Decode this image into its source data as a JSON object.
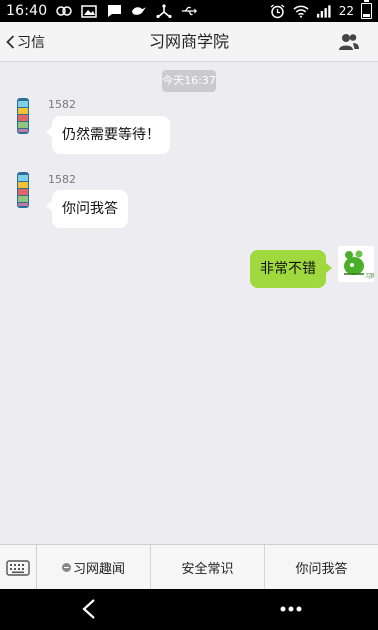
{
  "status_bar": {
    "time": "16:40",
    "battery_level": "22",
    "battery_fraction": 0.22,
    "icons": [
      "circles-icon",
      "image-icon",
      "message-icon",
      "bird-icon",
      "network-icon",
      "usb-icon",
      "alarm-icon",
      "wifi-icon",
      "signal-icon",
      "battery-icon"
    ]
  },
  "header": {
    "back_label": "习信",
    "title": "习网商学院",
    "right_icon": "people-icon"
  },
  "chat": {
    "timestamp": "今天16:37",
    "messages": [
      {
        "sender": "1582",
        "side": "left",
        "text": "仍然需要等待！"
      },
      {
        "sender": "1582",
        "side": "left",
        "text": "你问我答"
      },
      {
        "sender": "",
        "side": "right",
        "text": "非常不错",
        "avatar_text": "习网"
      }
    ]
  },
  "menu": {
    "keyboard_icon": "keyboard-icon",
    "items": [
      {
        "label": "习网趣闻",
        "has_submenu": true
      },
      {
        "label": "安全常识",
        "has_submenu": false
      },
      {
        "label": "你问我答",
        "has_submenu": false
      }
    ]
  },
  "colors": {
    "chat_background": "#ececf1",
    "my_bubble": "#9fd93d",
    "other_bubble": "#ffffff",
    "timestamp_pill": "#cbcbcf"
  }
}
